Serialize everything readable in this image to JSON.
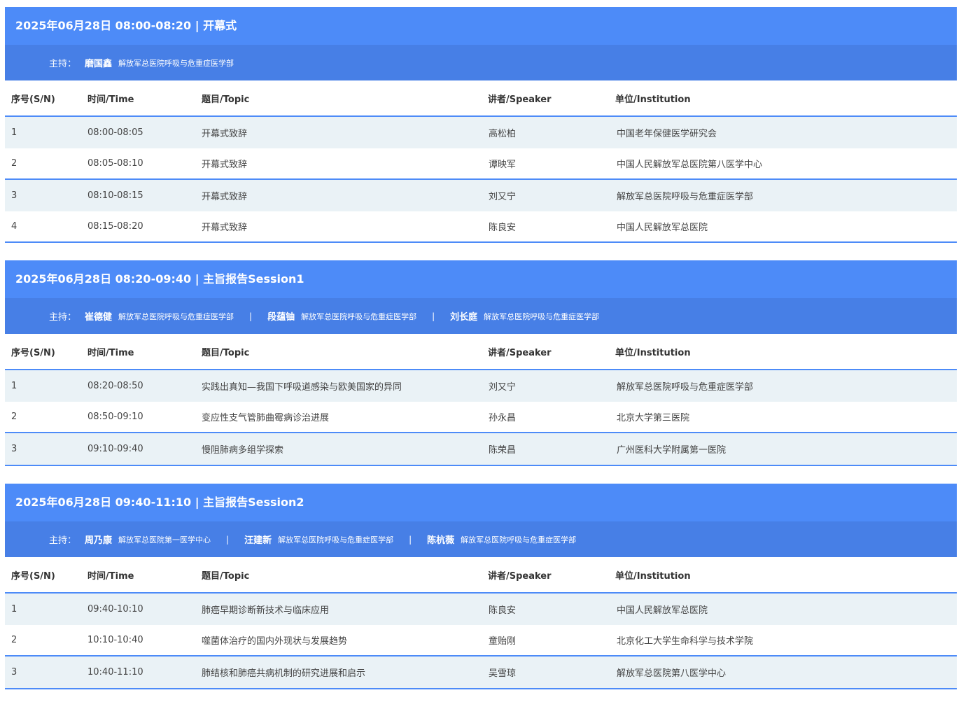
{
  "columns": {
    "sn": "序号(S/N)",
    "time": "时间/Time",
    "topic": "题目/Topic",
    "speaker": "讲者/Speaker",
    "institution": "单位/Institution"
  },
  "host_label": "主持：",
  "host_separator": "|",
  "accent_color": "#4d8bf8",
  "sessions": [
    {
      "title": "2025年06月28日 08:00-08:20 | 开幕式",
      "hosts": [
        {
          "name": "磨国鑫",
          "institution": "解放军总医院呼吸与危重症医学部"
        }
      ],
      "rows": [
        {
          "sn": "1",
          "time": "08:00-08:05",
          "topic": "开幕式致辞",
          "speaker": "高松柏",
          "institution": "中国老年保健医学研究会"
        },
        {
          "sn": "2",
          "time": "08:05-08:10",
          "topic": "开幕式致辞",
          "speaker": "谭映军",
          "institution": "中国人民解放军总医院第八医学中心"
        },
        {
          "sn": "3",
          "time": "08:10-08:15",
          "topic": "开幕式致辞",
          "speaker": "刘又宁",
          "institution": "解放军总医院呼吸与危重症医学部"
        },
        {
          "sn": "4",
          "time": "08:15-08:20",
          "topic": "开幕式致辞",
          "speaker": "陈良安",
          "institution": "中国人民解放军总医院"
        }
      ]
    },
    {
      "title": "2025年06月28日 08:20-09:40 | 主旨报告Session1",
      "hosts": [
        {
          "name": "崔德健",
          "institution": "解放军总医院呼吸与危重症医学部"
        },
        {
          "name": "段蕴铀",
          "institution": "解放军总医院呼吸与危重症医学部"
        },
        {
          "name": "刘长庭",
          "institution": "解放军总医院呼吸与危重症医学部"
        }
      ],
      "rows": [
        {
          "sn": "1",
          "time": "08:20-08:50",
          "topic": "实践出真知—我国下呼吸道感染与欧美国家的异同",
          "speaker": "刘又宁",
          "institution": "解放军总医院呼吸与危重症医学部"
        },
        {
          "sn": "2",
          "time": "08:50-09:10",
          "topic": "变应性支气管肺曲霉病诊治进展",
          "speaker": "孙永昌",
          "institution": "北京大学第三医院"
        },
        {
          "sn": "3",
          "time": "09:10-09:40",
          "topic": "慢阻肺病多组学探索",
          "speaker": "陈荣昌",
          "institution": "广州医科大学附属第一医院"
        }
      ]
    },
    {
      "title": "2025年06月28日 09:40-11:10 | 主旨报告Session2",
      "hosts": [
        {
          "name": "周乃康",
          "institution": "解放军总医院第一医学中心"
        },
        {
          "name": "汪建新",
          "institution": "解放军总医院呼吸与危重症医学部"
        },
        {
          "name": "陈杭薇",
          "institution": "解放军总医院呼吸与危重症医学部"
        }
      ],
      "rows": [
        {
          "sn": "1",
          "time": "09:40-10:10",
          "topic": "肺癌早期诊断新技术与临床应用",
          "speaker": "陈良安",
          "institution": "中国人民解放军总医院"
        },
        {
          "sn": "2",
          "time": "10:10-10:40",
          "topic": "噬菌体治疗的国内外现状与发展趋势",
          "speaker": "童贻刚",
          "institution": "北京化工大学生命科学与技术学院"
        },
        {
          "sn": "3",
          "time": "10:40-11:10",
          "topic": "肺结核和肺癌共病机制的研究进展和启示",
          "speaker": "吴雪琼",
          "institution": "解放军总医院第八医学中心"
        }
      ]
    }
  ]
}
